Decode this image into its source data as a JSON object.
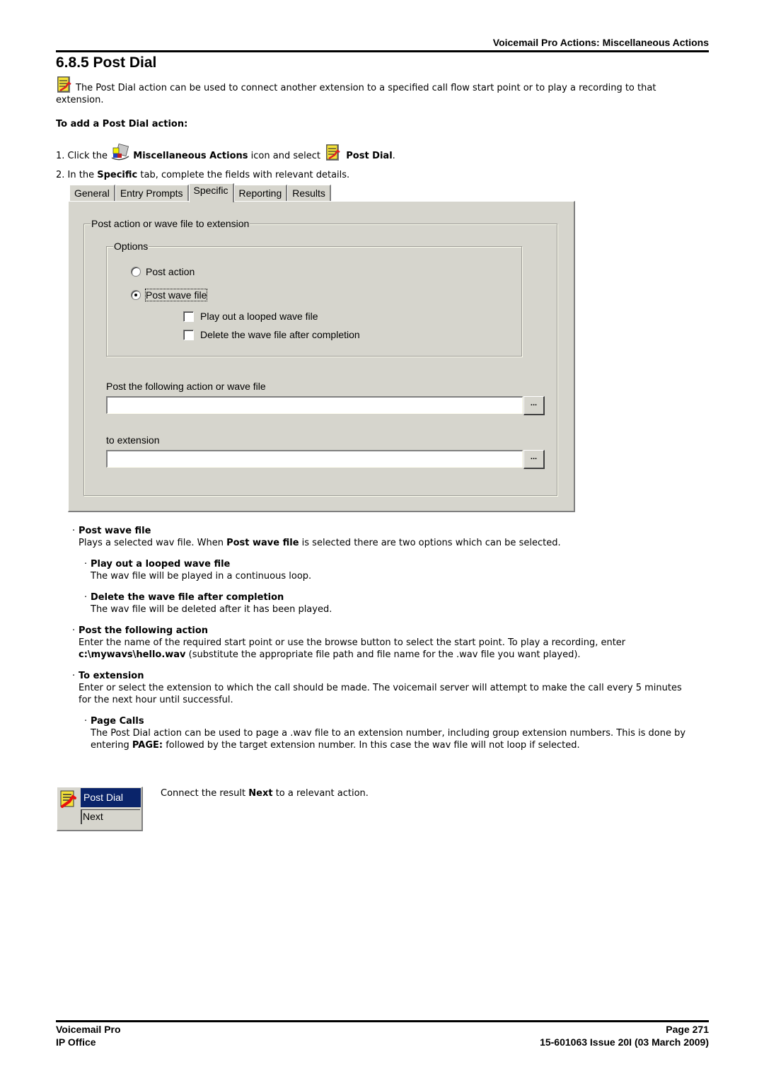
{
  "header": {
    "section": "Voicemail Pro Actions: Miscellaneous Actions",
    "title": "6.8.5 Post Dial"
  },
  "intro": {
    "icon": "post-dial-icon",
    "text": "The Post Dial action can be used to connect another extension to a specified call flow start point or to play a recording to that extension."
  },
  "procedure": {
    "heading": "To add a Post Dial action:",
    "step1": {
      "num": "1.",
      "pre": "Click the",
      "icon1": "miscellaneous-actions-icon",
      "bold1": "Miscellaneous Actions",
      "mid": "icon and select",
      "icon2": "post-dial-icon",
      "bold2": "Post Dial",
      "end": "."
    },
    "step2": {
      "num": "2.",
      "pre": "In the",
      "bold": "Specific",
      "post": "tab, complete the fields with relevant details."
    }
  },
  "dialog": {
    "tabs": [
      {
        "label": "General",
        "active": false
      },
      {
        "label": "Entry Prompts",
        "active": false
      },
      {
        "label": "Specific",
        "active": true
      },
      {
        "label": "Reporting",
        "active": false
      },
      {
        "label": "Results",
        "active": false
      }
    ],
    "outer_group": "Post action or wave file to extension",
    "options_group": "Options",
    "radios": [
      {
        "label": "Post action",
        "checked": false
      },
      {
        "label": "Post wave file",
        "checked": true
      }
    ],
    "checkboxes": [
      {
        "label": "Play out a looped wave file",
        "checked": false
      },
      {
        "label": "Delete the wave file after completion",
        "checked": false
      }
    ],
    "field1": {
      "label": "Post the following action or wave file",
      "value": "",
      "browse": "..."
    },
    "field2": {
      "label": "to extension",
      "value": "",
      "browse": "..."
    }
  },
  "descriptions": [
    {
      "head": "Post wave file",
      "text_pre": "Plays a selected wav file. When ",
      "bold": "Post wave file",
      "text_post": " is selected there are two options which can be selected."
    },
    {
      "head": "Play out a looped wave file",
      "text": "The wav file will be played in a continuous loop."
    },
    {
      "head": "Delete the wave file after completion",
      "text": "The wav file will be deleted after it has been played."
    },
    {
      "head": "Post the following action",
      "text_pre": "Enter the name of the required start point or use the browse button to select the start point. To play a recording, enter ",
      "bold": "c:\\mywavs\\hello.wav",
      "text_post": " (substitute the appropriate file path and file name for the .wav file you want played)."
    },
    {
      "head": "To extension",
      "text": "Enter or select the extension to which the call should be made. The voicemail server will attempt to make the call every 5 minutes for the next hour until successful."
    },
    {
      "head": "Page Calls",
      "text_pre": "The Post Dial action can be used to page a .wav file to an extension number, including group extension numbers. This is done by entering ",
      "bold": "PAGE:",
      "text_post": " followed by the target extension number. In this case the wav file will not loop if selected."
    }
  ],
  "result_node": {
    "title": "Post Dial",
    "result": "Next",
    "text_pre": "Connect the result ",
    "bold": "Next",
    "text_post": " to a relevant action."
  },
  "footer": {
    "left1": "Voicemail Pro",
    "left2": "IP Office",
    "right1": "Page 271",
    "right2": "15-601063 Issue 20I (03 March 2009)"
  }
}
